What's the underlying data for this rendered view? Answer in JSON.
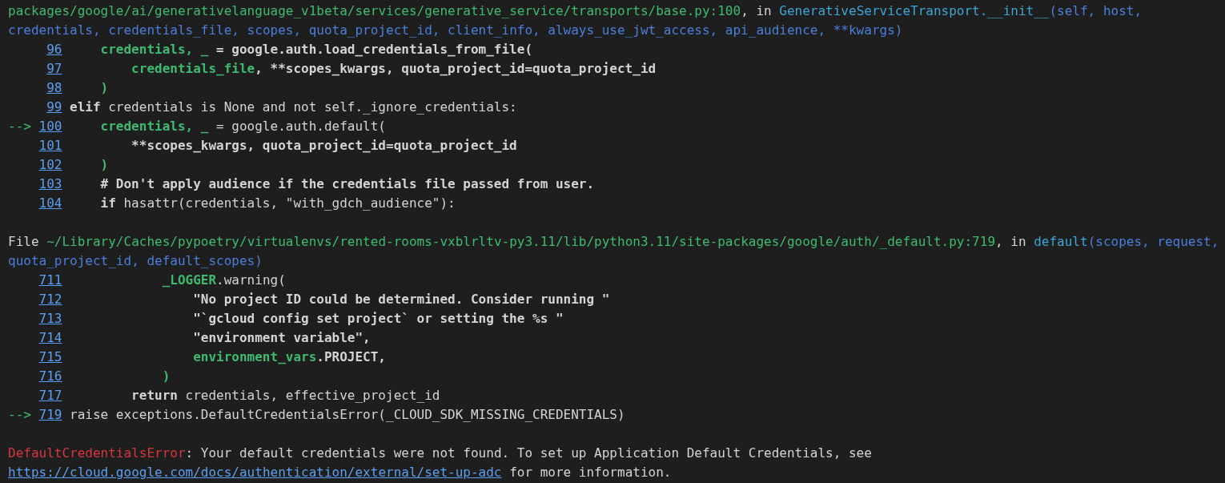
{
  "frames": [
    {
      "header": [
        [
          {
            "text": "packages/google/ai/generativelanguage_v1beta/services/generative_service/transports/base.py:100",
            "kind": "path"
          },
          {
            "text": ", in ",
            "kind": "plain"
          },
          {
            "text": "GenerativeServiceTransport.__init__",
            "kind": "func"
          },
          {
            "text": "(self, host,",
            "kind": "args"
          }
        ],
        [
          {
            "text": "credentials, credentials_file, scopes, quota_project_id, client_info, always_use_jwt_access, api_audience, **kwargs)",
            "kind": "args"
          }
        ]
      ],
      "lines": [
        {
          "number": "96",
          "tokens": [
            {
              "text": "    credentials, _",
              "kind": "name"
            },
            {
              "text": " = google.auth.load_credentials_from_file(",
              "kind": "bold"
            }
          ]
        },
        {
          "number": "97",
          "tokens": [
            {
              "text": "        credentials_file",
              "kind": "name"
            },
            {
              "text": ", **scopes_kwargs, quota_project_id=quota_project_id",
              "kind": "bold"
            }
          ]
        },
        {
          "number": "98",
          "tokens": [
            {
              "text": "    )",
              "kind": "name"
            }
          ]
        },
        {
          "number": "99",
          "tokens": [
            {
              "text": "elif",
              "kind": "bold"
            },
            {
              "text": " credentials is None and not self._ignore_credentials:",
              "kind": "plain"
            }
          ]
        },
        {
          "number": "100",
          "arrow": "-->",
          "tokens": [
            {
              "text": "    credentials, _",
              "kind": "name"
            },
            {
              "text": " = google.auth.default(",
              "kind": "plain"
            }
          ]
        },
        {
          "number": "101",
          "tokens": [
            {
              "text": "        **scopes_kwargs, quota_project_id=quota_project_id",
              "kind": "bold"
            }
          ]
        },
        {
          "number": "102",
          "tokens": [
            {
              "text": "    )",
              "kind": "name"
            }
          ]
        },
        {
          "number": "103",
          "tokens": [
            {
              "text": "    # Don't apply audience if the credentials file passed from user.",
              "kind": "bold"
            }
          ]
        },
        {
          "number": "104",
          "tokens": [
            {
              "text": "    if",
              "kind": "bold"
            },
            {
              "text": " hasattr(credentials, \"with_gdch_audience\"):",
              "kind": "plain"
            }
          ]
        }
      ]
    },
    {
      "header": [
        [
          {
            "text": "File ",
            "kind": "plain"
          },
          {
            "text": "~/Library/Caches/pypoetry/virtualenvs/rented-rooms-vxblrltv-py3.11/lib/python3.11/site-packages/google/auth/_default.py:719",
            "kind": "path"
          },
          {
            "text": ", in ",
            "kind": "plain"
          },
          {
            "text": "default",
            "kind": "func"
          },
          {
            "text": "(scopes, request,",
            "kind": "args"
          }
        ],
        [
          {
            "text": "quota_project_id, default_scopes)",
            "kind": "args"
          }
        ]
      ],
      "lines": [
        {
          "number": "711",
          "tokens": [
            {
              "text": "            _LOGGER",
              "kind": "name"
            },
            {
              "text": ".warning(",
              "kind": "plain"
            }
          ]
        },
        {
          "number": "712",
          "tokens": [
            {
              "text": "                \"No project ID could be determined. Consider running \"",
              "kind": "bold"
            }
          ]
        },
        {
          "number": "713",
          "tokens": [
            {
              "text": "                \"`gcloud config set project` or setting the %s \"",
              "kind": "bold"
            }
          ]
        },
        {
          "number": "714",
          "tokens": [
            {
              "text": "                \"environment variable\",",
              "kind": "bold"
            }
          ]
        },
        {
          "number": "715",
          "tokens": [
            {
              "text": "                environment_vars",
              "kind": "name"
            },
            {
              "text": ".PROJECT,",
              "kind": "bold"
            }
          ]
        },
        {
          "number": "716",
          "tokens": [
            {
              "text": "            )",
              "kind": "name"
            }
          ]
        },
        {
          "number": "717",
          "tokens": [
            {
              "text": "        return",
              "kind": "bold"
            },
            {
              "text": " credentials, effective_project_id",
              "kind": "plain"
            }
          ]
        },
        {
          "number": "719",
          "arrow": "-->",
          "tokens": [
            {
              "text": "raise exceptions.DefaultCredentialsError(_CLOUD_SDK_MISSING_CREDENTIALS)",
              "kind": "plain"
            }
          ]
        }
      ]
    }
  ],
  "error": {
    "type": "DefaultCredentialsError",
    "message": ": Your default credentials were not found. To set up Application Default Credentials, see",
    "link": "https://cloud.google.com/docs/authentication/external/set-up-adc",
    "after": " for more information."
  }
}
